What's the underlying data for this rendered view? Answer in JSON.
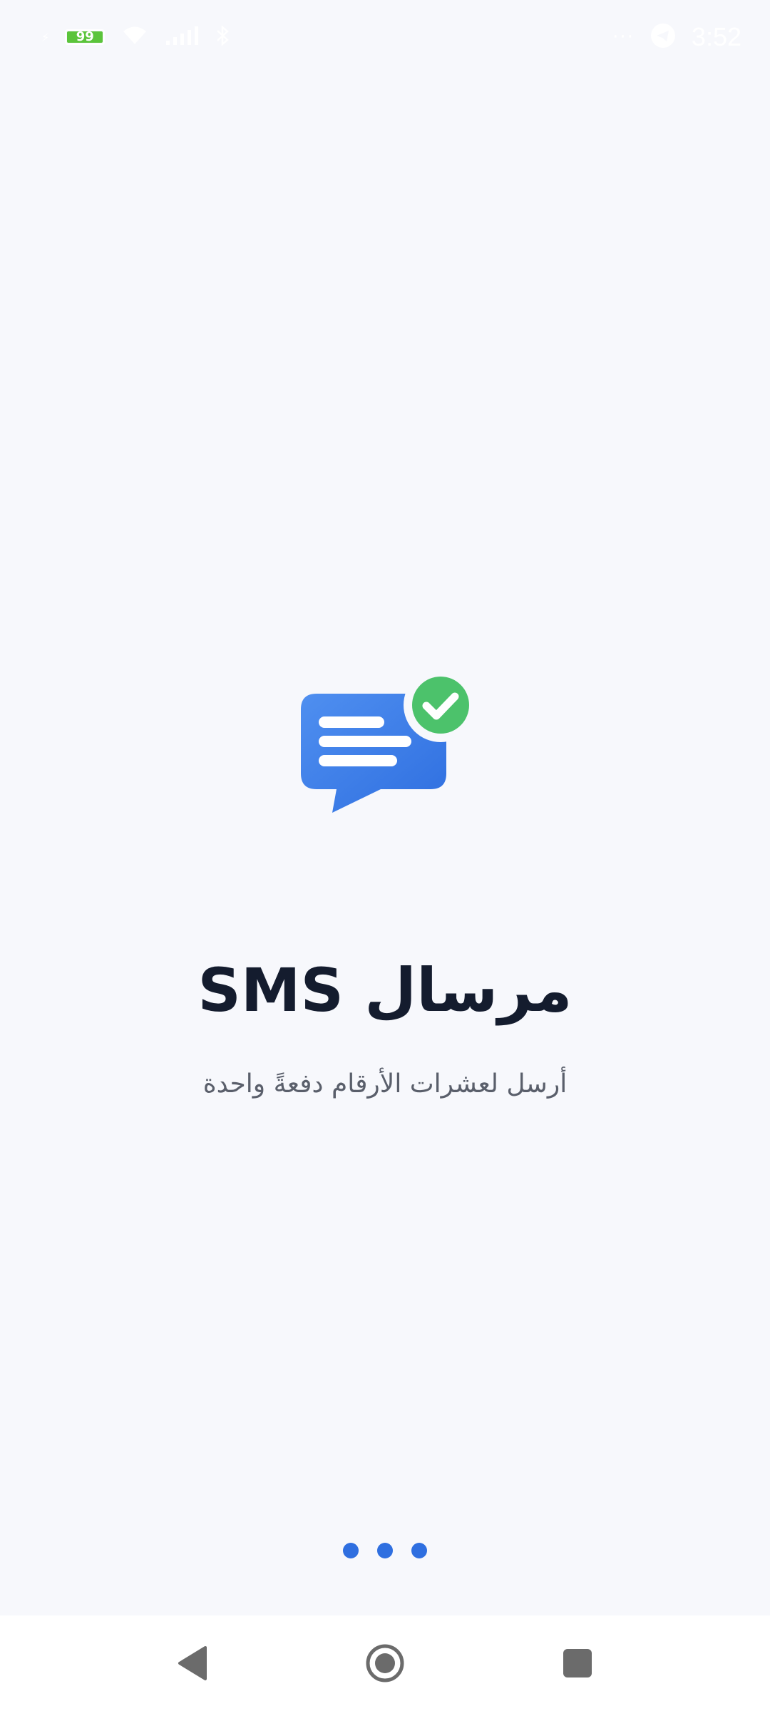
{
  "status_bar": {
    "battery_level": "99",
    "battery_fraction": 0.99,
    "time": "3:52",
    "icons": [
      "charging-icon",
      "battery-icon",
      "wifi-icon",
      "signal-icon",
      "bluetooth-icon",
      "more-dots-icon",
      "telegram-icon"
    ]
  },
  "app": {
    "title": "مرسال SMS",
    "subtitle": "أرسل لعشرات الأرقام دفعةً واحدة",
    "logo_icon": "chat-bubble-check-icon",
    "accent_color": "#2f6fe0",
    "check_color": "#4cc26b"
  },
  "pager": {
    "page_count": 3
  },
  "nav_bar": {
    "icons": [
      "back-icon",
      "home-icon",
      "recents-icon"
    ]
  }
}
